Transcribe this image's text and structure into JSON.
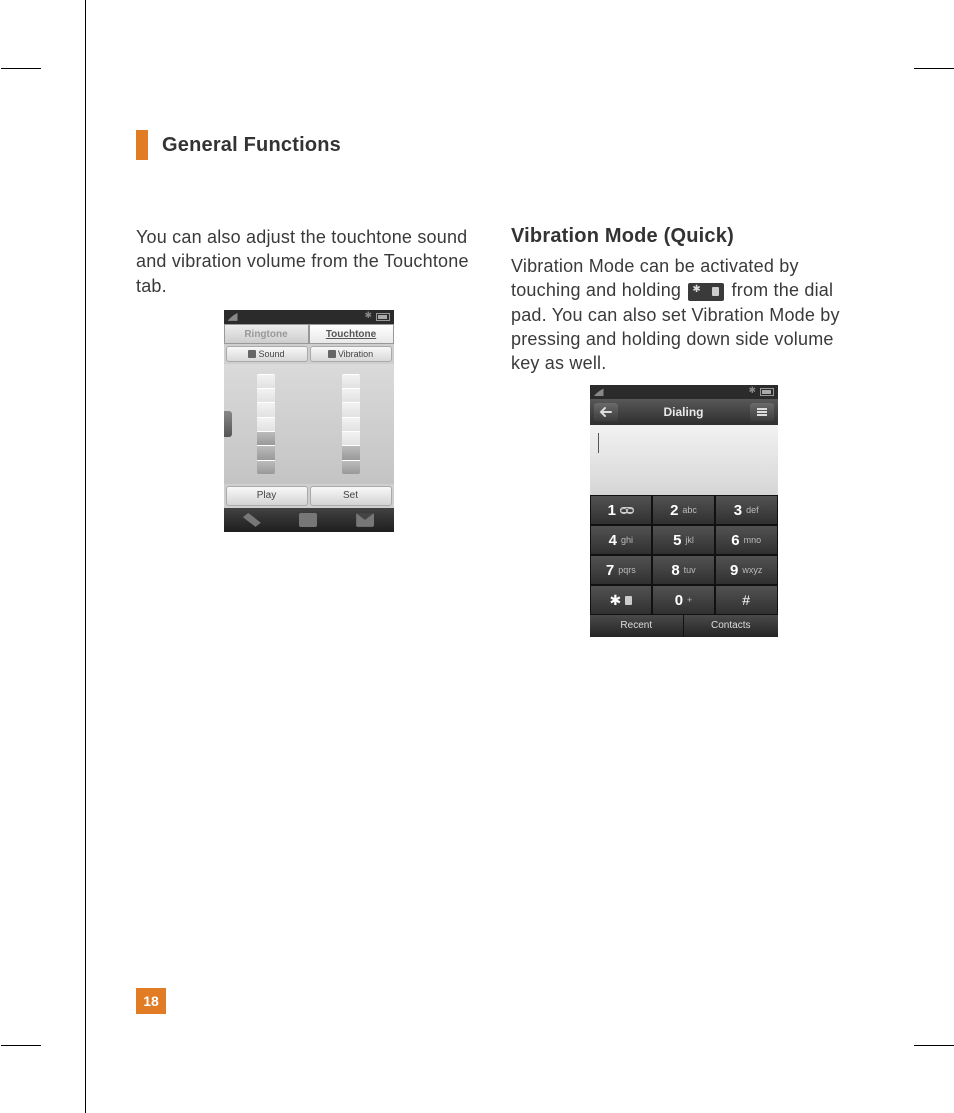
{
  "page_number": "18",
  "header_title": "General Functions",
  "left": {
    "intro": "You can also adjust the touchtone sound and vibration volume from the Touchtone tab.",
    "tabs": {
      "ringtone": "Ringtone",
      "touchtone": "Touchtone"
    },
    "subtabs": {
      "sound": "Sound",
      "vibration": "Vibration"
    },
    "slider_levels": {
      "total": 7,
      "sound_on": 3,
      "vibration_on": 2
    },
    "buttons": {
      "play": "Play",
      "set": "Set"
    }
  },
  "right": {
    "heading": "Vibration Mode (Quick)",
    "para_pre": "Vibration Mode can be activated by touching and holding ",
    "para_post": " from the dial pad. You can also set Vibration Mode by pressing and holding down side volume key as well.",
    "dialer": {
      "title": "Dialing",
      "keys": [
        [
          {
            "n": "1",
            "s": ""
          },
          {
            "n": "2",
            "s": "abc"
          },
          {
            "n": "3",
            "s": "def"
          }
        ],
        [
          {
            "n": "4",
            "s": "ghi"
          },
          {
            "n": "5",
            "s": "jkl"
          },
          {
            "n": "6",
            "s": "mno"
          }
        ],
        [
          {
            "n": "7",
            "s": "pqrs"
          },
          {
            "n": "8",
            "s": "tuv"
          },
          {
            "n": "9",
            "s": "wxyz"
          }
        ],
        [
          {
            "n": "✱",
            "s": ""
          },
          {
            "n": "0",
            "s": "+"
          },
          {
            "n": "#",
            "s": ""
          }
        ]
      ],
      "tabs": {
        "recent": "Recent",
        "contacts": "Contacts"
      }
    }
  }
}
